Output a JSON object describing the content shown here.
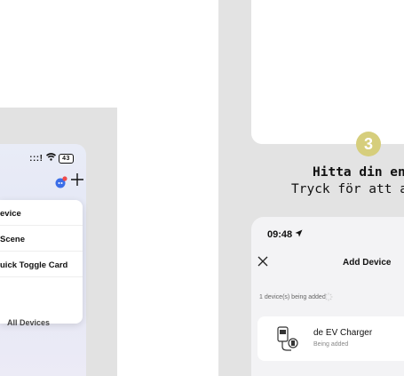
{
  "left": {
    "status_signal": ":::!",
    "status_wifi": "ᯤ",
    "battery_level": "43",
    "menu_items": [
      "evice",
      "Scene",
      "uick Toggle Card",
      ""
    ],
    "hidden_label": "All Devices"
  },
  "right": {
    "step_number": "3",
    "step_line1": "Hitta din enh",
    "step_line2": "Tryck för att a",
    "time": "09:48",
    "title": "Add Device",
    "adding_status": "1 device(s) being added",
    "device_name": "de EV Charger",
    "device_status": "Being added"
  },
  "colors": {
    "badge": "#d6ce7c",
    "panel_bg": "#e3e3e3"
  }
}
